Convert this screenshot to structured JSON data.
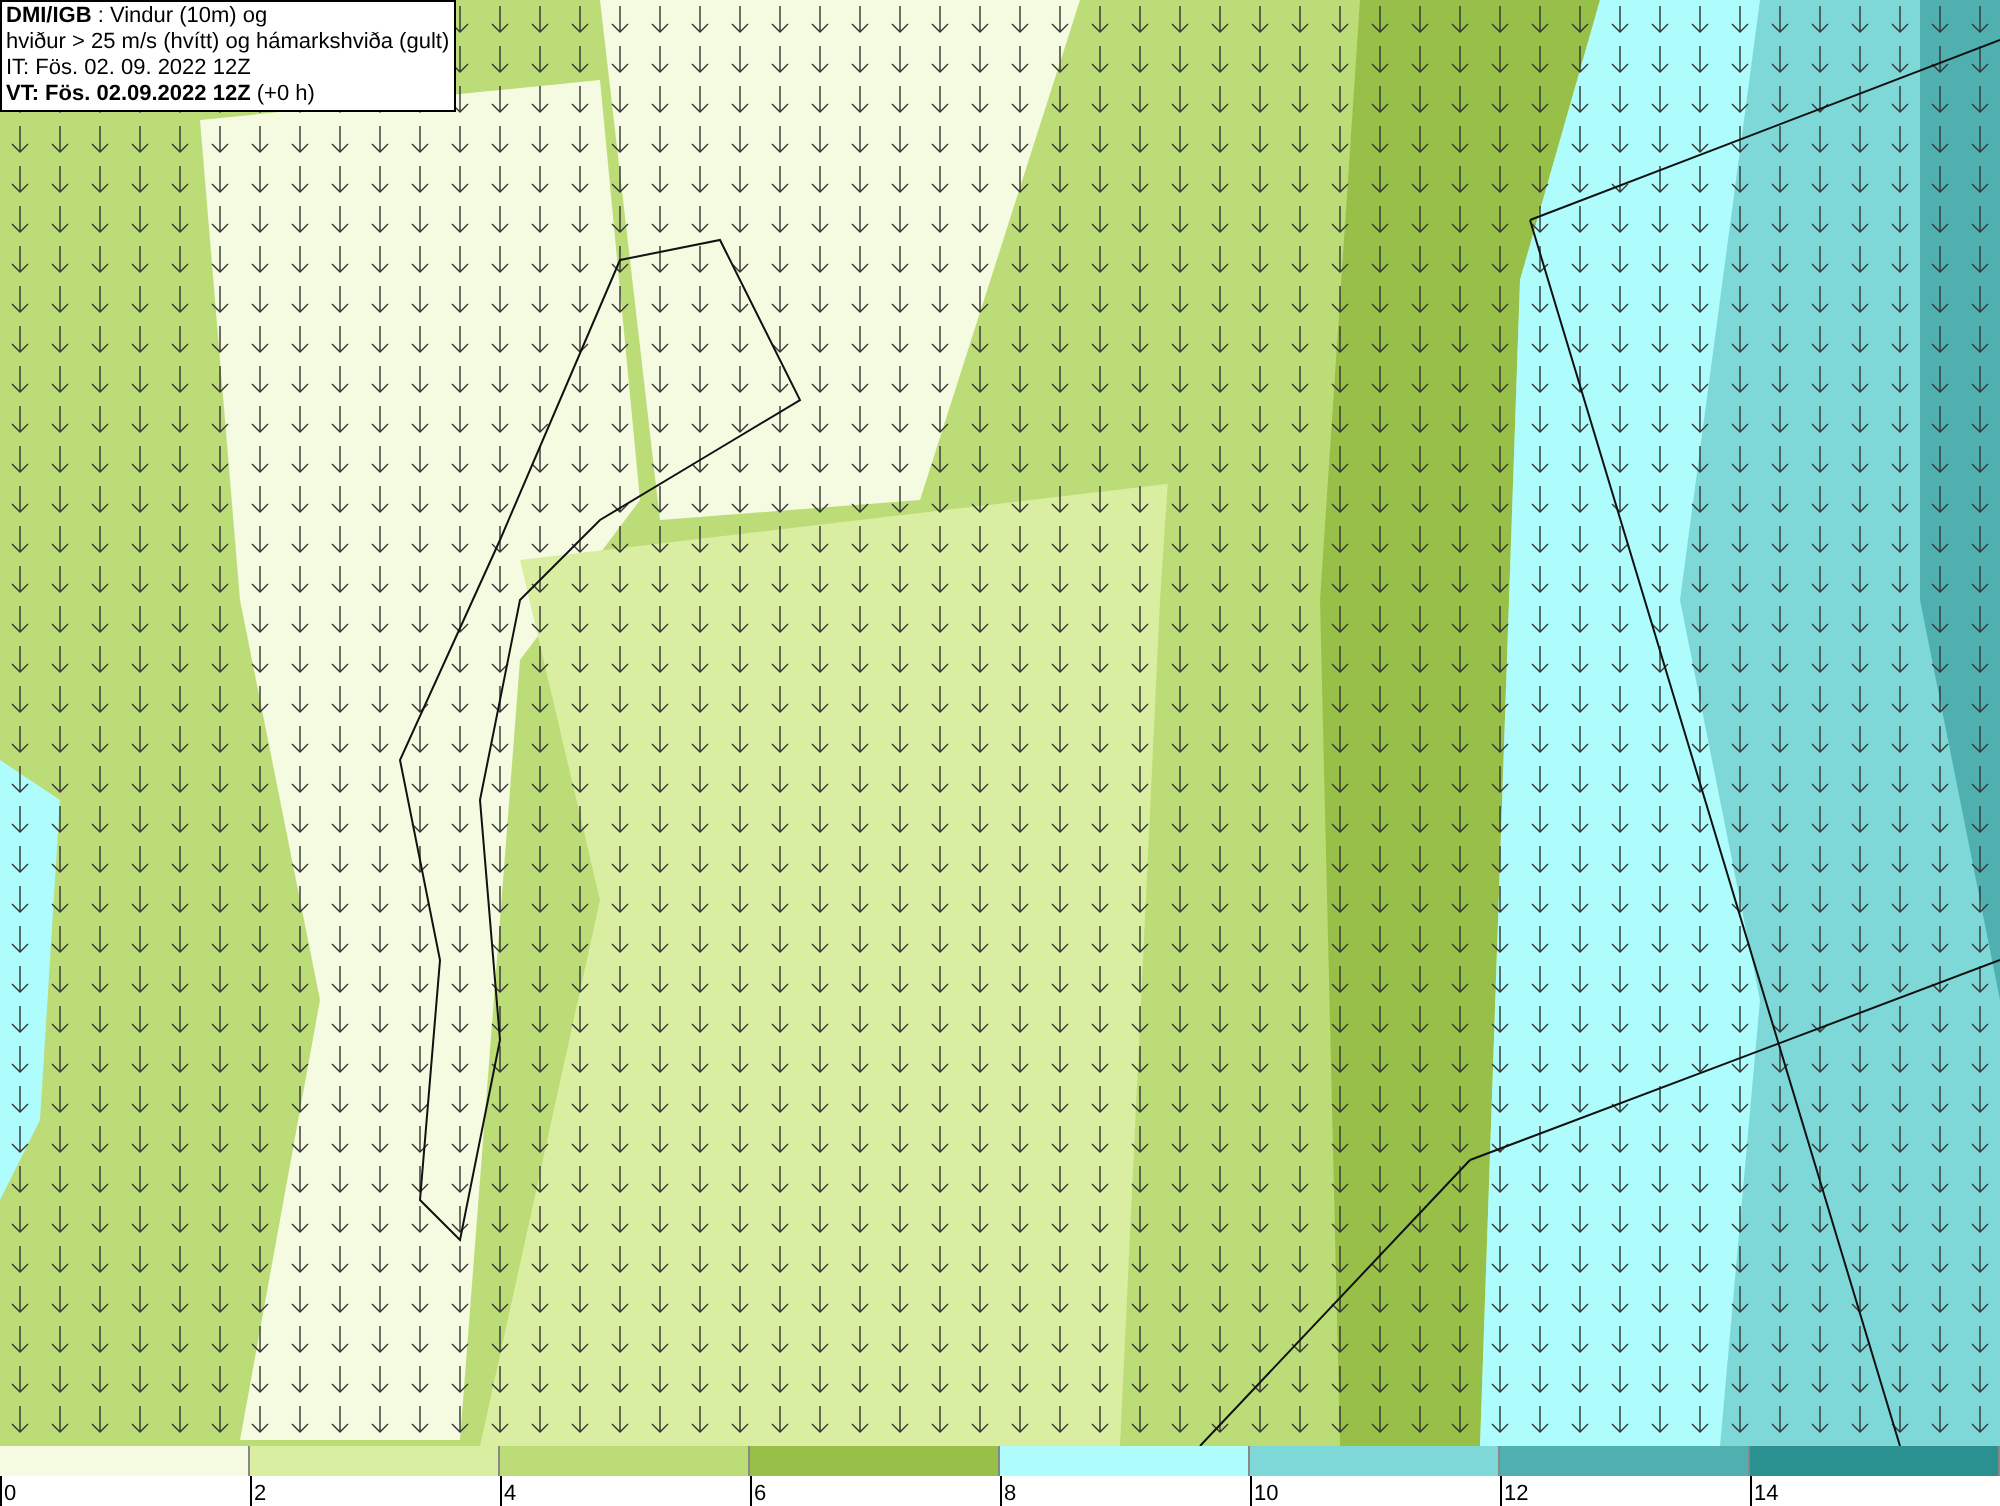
{
  "info_box": {
    "lines": [
      "**DMI/IGB** : Vindur (10m) og",
      "hviður > 25 m/s (hvítt) og hámarkshviða (gult)",
      "IT: Fös. 02. 09. 2022 12Z",
      "**VT: Fös. 02.09.2022 12Z** (+0 h)"
    ]
  },
  "legend": [
    {
      "label": "0",
      "color": "#f5fbe0"
    },
    {
      "label": "2",
      "color": "#d9eea0"
    },
    {
      "label": "4",
      "color": "#bcdc78"
    },
    {
      "label": "6",
      "color": "#98c048"
    },
    {
      "label": "8",
      "color": "#aefcfc"
    },
    {
      "label": "10",
      "color": "#7fd8d8"
    },
    {
      "label": "12",
      "color": "#50b0b0"
    },
    {
      "label": "14",
      "color": "#2a9090"
    }
  ]
}
